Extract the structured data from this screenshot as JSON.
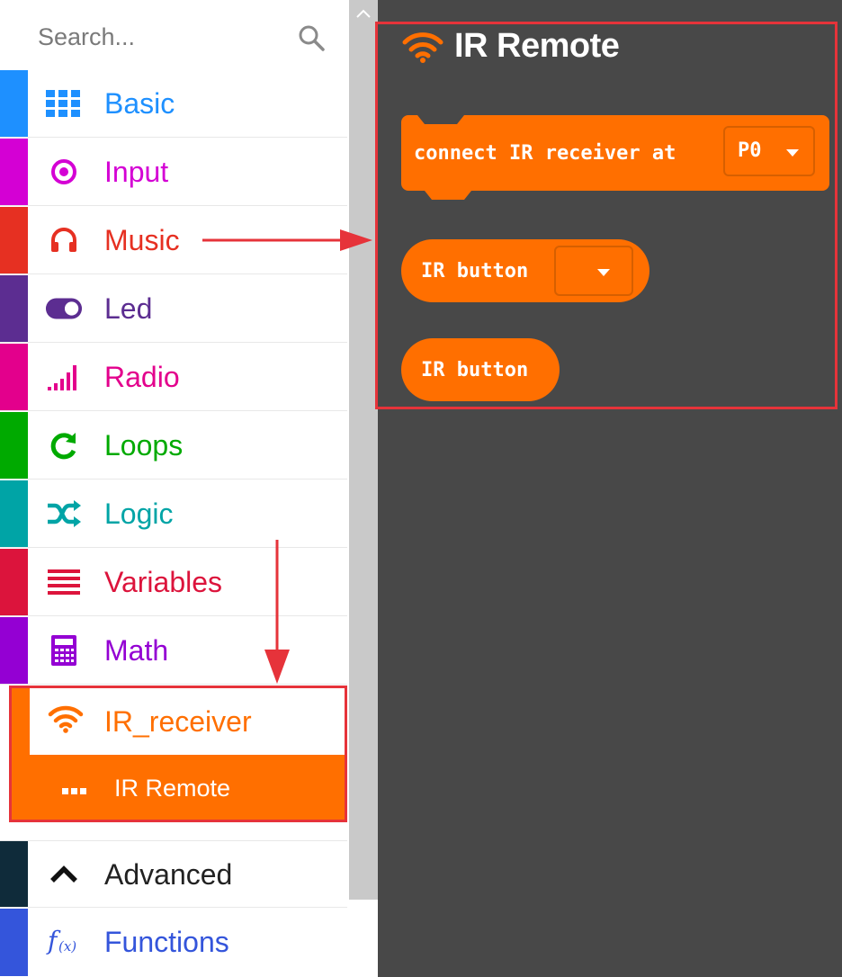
{
  "search": {
    "placeholder": "Search..."
  },
  "categories": [
    {
      "label": "Basic",
      "color": "#1e90ff",
      "icon": "grid-icon"
    },
    {
      "label": "Input",
      "color": "#d400d4",
      "icon": "target-icon"
    },
    {
      "label": "Music",
      "color": "#e63022",
      "icon": "headphones-icon"
    },
    {
      "label": "Led",
      "color": "#5c2d91",
      "icon": "toggle-icon"
    },
    {
      "label": "Radio",
      "color": "#e3008c",
      "icon": "signal-bars-icon"
    },
    {
      "label": "Loops",
      "color": "#00aa00",
      "icon": "refresh-icon"
    },
    {
      "label": "Logic",
      "color": "#00a4a6",
      "icon": "shuffle-icon"
    },
    {
      "label": "Variables",
      "color": "#dc143c",
      "icon": "list-icon"
    },
    {
      "label": "Math",
      "color": "#9400d3",
      "icon": "calculator-icon"
    }
  ],
  "ir_receiver": {
    "label": "IR_receiver",
    "color": "#ff6f00",
    "icon": "wifi-icon",
    "subcategory": {
      "label": "IR Remote",
      "icon": "dots-icon"
    }
  },
  "advanced": {
    "label": "Advanced",
    "color": "#0f2b3a",
    "icon": "chevron-up-icon"
  },
  "functions": {
    "label": "Functions",
    "color": "#3455db",
    "icon": "function-icon"
  },
  "flyout": {
    "title": "IR Remote",
    "title_icon": "wifi-icon",
    "background": "#484848",
    "block_color": "#ff6f00",
    "blocks": [
      {
        "text": "connect IR receiver at",
        "dropdown": "P0"
      },
      {
        "text": "IR button",
        "dropdown": ""
      },
      {
        "text": "IR button"
      }
    ]
  },
  "highlight_color": "#e6333a"
}
